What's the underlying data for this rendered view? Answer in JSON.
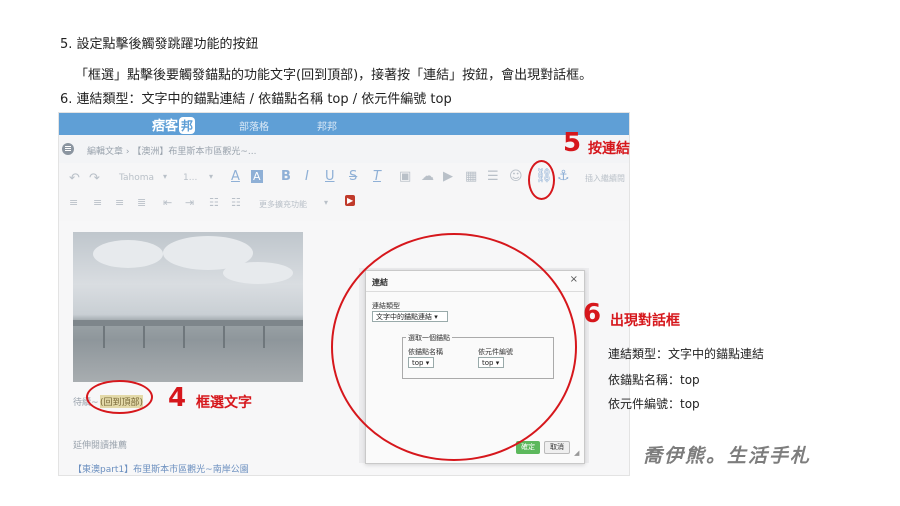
{
  "instructions": {
    "step5_heading": "5. 設定點擊後觸發跳躍功能的按鈕",
    "step5_detail": "「框選」點擊後要觸發錨點的功能文字(回到頂部)，接著按「連結」按鈕，會出現對話框。",
    "step6_heading": "6. 連結類型：文字中的錨點連結 /  依錨點名稱 top  / 依元件編號 top"
  },
  "editor": {
    "logo": "痞客",
    "logo_badge": "邦",
    "nav_blog": "部落格",
    "nav_bangbang": "邦邦",
    "breadcrumb": "編輯文章 › 【澳洲】布里斯本市區觀光~...",
    "toolbar": {
      "font_name": "Tahoma",
      "font_size": "1...",
      "insert_label": "插入繼續閱",
      "more_features": "更多擴充功能"
    },
    "content": {
      "wait_text": "待續~",
      "back_to_top": "(回到頂部)",
      "extended_reading": "延伸閱讀推薦",
      "related_link": "【東澳part1】布里斯本市區觀光~南岸公園"
    }
  },
  "dialog": {
    "title": "連結",
    "close": "×",
    "link_type_label": "連結類型",
    "link_type_value": "文字中的錨點連結",
    "anchor_group_label": "選取一個錨點",
    "by_name_label": "依錨點名稱",
    "by_name_value": "top",
    "by_id_label": "依元件編號",
    "by_id_value": "top",
    "ok_label": "確定",
    "cancel_label": "取消"
  },
  "annotations": {
    "step4_num": "4",
    "step4_label": "框選文字",
    "step5_num": "5",
    "step5_label": "按連結",
    "step6_num": "6",
    "step6_label": "出現對話框",
    "accent_color": "#d6171c"
  },
  "side_notes": [
    "連結類型：文字中的錨點連結",
    "依錨點名稱：top",
    "依元件編號：top"
  ],
  "watermark": "喬伊熊。生活手札"
}
